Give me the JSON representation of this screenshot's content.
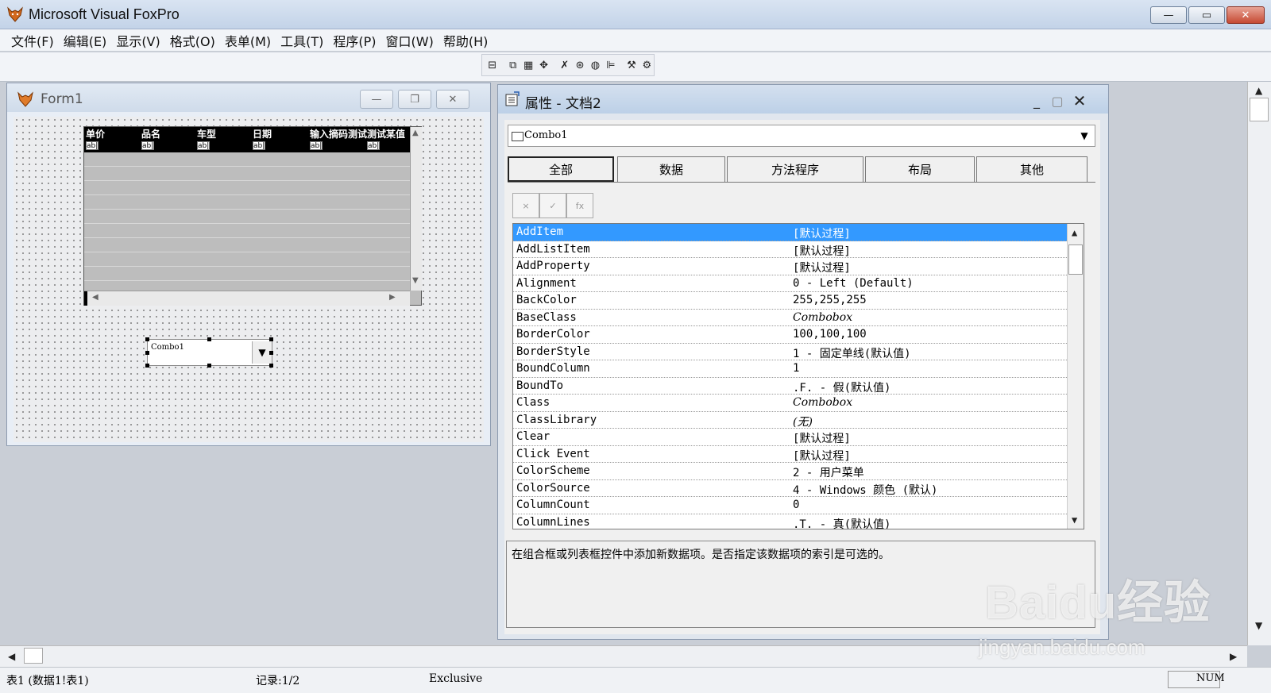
{
  "app": {
    "title": "Microsoft Visual FoxPro",
    "controls": {
      "minimize": "—",
      "maximize": "▭",
      "close": "✕"
    }
  },
  "menu": [
    "文件(F)",
    "编辑(E)",
    "显示(V)",
    "格式(O)",
    "表单(M)",
    "工具(T)",
    "程序(P)",
    "窗口(W)",
    "帮助(H)"
  ],
  "toolbar": {
    "icons": [
      "align-icon",
      "tab-order-icon",
      "data-environment-icon",
      "properties-icon",
      "code-icon",
      "form-controls-icon",
      "color-palette-icon",
      "layout-icon",
      "form-builder-icon",
      "autoformat-icon"
    ]
  },
  "form1": {
    "title": "Form1",
    "grid": {
      "columns": [
        "单价",
        "品名",
        "车型",
        "日期",
        "输入摘码测试",
        "测试某值"
      ],
      "cell_tag": "ab|"
    },
    "combo": {
      "text": "Combo1"
    }
  },
  "properties": {
    "title": "属性 - 文档2",
    "object": "Combo1",
    "tabs": [
      "全部",
      "数据",
      "方法程序",
      "布局",
      "其他"
    ],
    "active_tab": 0,
    "edit_buttons": [
      "×",
      "✓",
      "fx"
    ],
    "rows": [
      {
        "name": "AddItem",
        "value": "[默认过程]",
        "selected": true
      },
      {
        "name": "AddListItem",
        "value": "[默认过程]"
      },
      {
        "name": "AddProperty",
        "value": "[默认过程]"
      },
      {
        "name": "Alignment",
        "value": "0 - Left (Default)"
      },
      {
        "name": "BackColor",
        "value": "255,255,255"
      },
      {
        "name": "BaseClass",
        "value": "Combobox",
        "italic": true
      },
      {
        "name": "BorderColor",
        "value": "100,100,100"
      },
      {
        "name": "BorderStyle",
        "value": "1 - 固定单线(默认值)"
      },
      {
        "name": "BoundColumn",
        "value": "1"
      },
      {
        "name": "BoundTo",
        "value": ".F. - 假(默认值)"
      },
      {
        "name": "Class",
        "value": "Combobox",
        "italic": true
      },
      {
        "name": "ClassLibrary",
        "value": "(无)",
        "italic": true
      },
      {
        "name": "Clear",
        "value": "[默认过程]"
      },
      {
        "name": "Click Event",
        "value": "[默认过程]"
      },
      {
        "name": "ColorScheme",
        "value": "2 - 用户菜单"
      },
      {
        "name": "ColorSource",
        "value": "4 - Windows 颜色 (默认)"
      },
      {
        "name": "ColumnCount",
        "value": "0"
      },
      {
        "name": "ColumnLines",
        "value": ".T. - 真(默认值)"
      }
    ],
    "description": "在组合框或列表框控件中添加新数据项。是否指定该数据项的索引是可选的。"
  },
  "status": {
    "table": "表1 (数据1!表1)",
    "record": "记录:1/2",
    "mode": "Exclusive",
    "num": "NUM"
  },
  "watermark": {
    "logo": "Baidu经验",
    "url": "jingyan.baidu.com"
  },
  "colors": {
    "selection": "#3399ff",
    "titlebar": "#c3d3e8",
    "grid_header": "#000000"
  }
}
